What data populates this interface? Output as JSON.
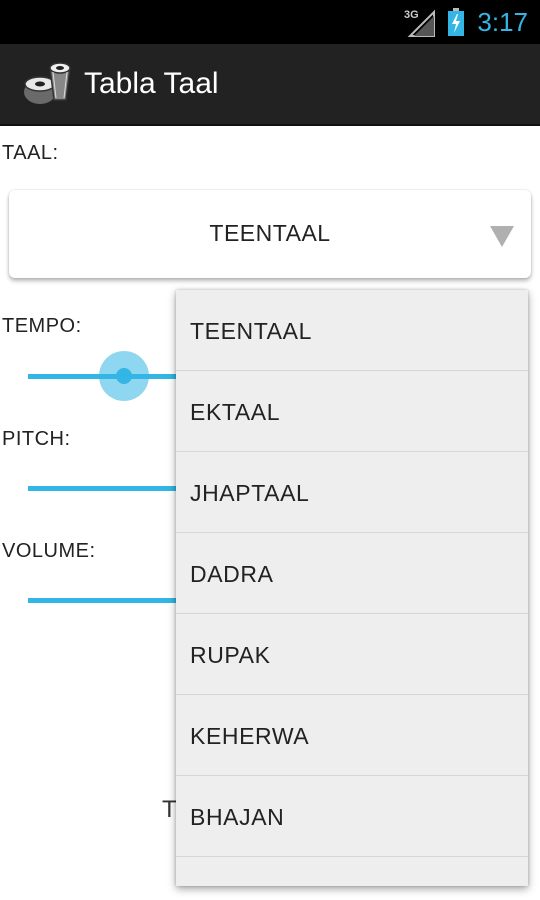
{
  "status_bar": {
    "network": "3G",
    "time": "3:17",
    "accent_color": "#33b5e5",
    "icons": [
      "signal-icon",
      "battery-charging-icon"
    ]
  },
  "action_bar": {
    "title": "Tabla Taal",
    "icon": "tabla-drum-icon"
  },
  "form": {
    "taal_label": "TAAL:",
    "taal_selected": "TEENTAAL",
    "tempo_label": "TEMPO:",
    "pitch_label": "PITCH:",
    "volume_label": "VOLUME:",
    "bottom_partial_text": "T"
  },
  "dropdown": {
    "options": [
      "TEENTAAL",
      "EKTAAL",
      "JHAPTAAL",
      "DADRA",
      "RUPAK",
      "KEHERWA",
      "BHAJAN"
    ]
  }
}
